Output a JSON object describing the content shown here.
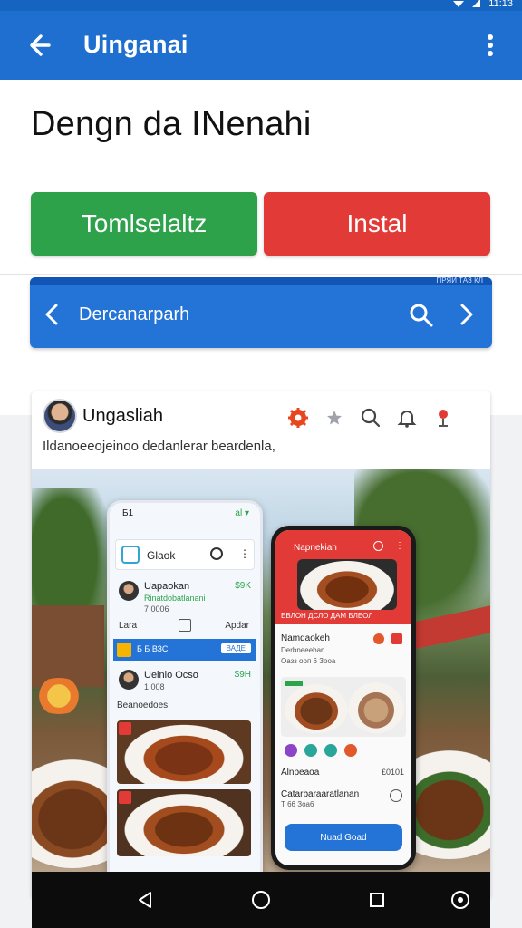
{
  "status_bar": {
    "left_text": "",
    "time": "11:13"
  },
  "app_bar": {
    "title": "Uinganai"
  },
  "heading": "Dengn da INenahi",
  "buttons": {
    "primary_left": "Tomlselaltz",
    "primary_right": "Instal"
  },
  "search_bar": {
    "text": "Dercanarparh",
    "top_strip_text": "ПРЯЙ ТАЗ КЛ"
  },
  "card": {
    "name": "Ungasliah",
    "description": "Ildanoeeojeinoo dedanlerar beardenla,",
    "phone_left": {
      "status_time": "Б1",
      "status_signal": "al ▾",
      "search_label": "Glaok",
      "row1": {
        "name": "Uapaokan",
        "price": "$9K",
        "sub1": "Rinatdobatlanani",
        "sub2": "7 0006"
      },
      "tabs": {
        "left": "Lara",
        "right": "Apdar"
      },
      "bluebar": {
        "text": "Б Б ВЗС",
        "tag": "ВАДЕ"
      },
      "row2": {
        "name": "Uelnlo Ocso",
        "price": "$9H",
        "sub": "1 008"
      },
      "section_title": "Beanoedoes"
    },
    "phone_right": {
      "header_title": "Napnekiah",
      "header_sub": "ЕВЛОН ДСЛО ДАМ БЛЕОЛ",
      "row1_title": "Namdaokeh",
      "row1_sub1": "Derbneeeban",
      "row1_sub2": "Оазз ооп 6 Зооа",
      "row2_title": "Alnpeaoa",
      "row2_price": "£0101",
      "row3_title": "Catarbaraaratlanan",
      "row3_sub": "Т 66 Зоа6",
      "cta": "Nuad Goad"
    }
  },
  "nav_bar": {
    "back": "back-triangle",
    "home": "home-circle",
    "recents": "recents-square",
    "assistant": "assistant-circle"
  },
  "colors": {
    "app_bar": "#1e6fd0",
    "green_button": "#2ea24a",
    "red_button": "#e23a36",
    "search_bar": "#2474d8"
  }
}
